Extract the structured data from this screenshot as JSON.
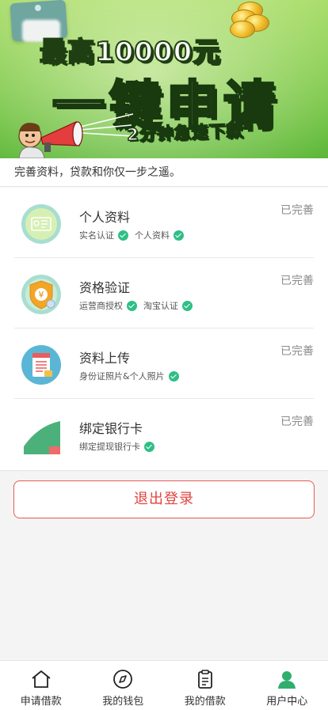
{
  "banner": {
    "headline": "最高10000元",
    "big_text": "一键申请",
    "sub_text": "2分钟急速下款"
  },
  "notice": "完善资料，贷款和你仅一步之遥。",
  "items": [
    {
      "title": "个人资料",
      "status": "已完善",
      "icon": "id-card-icon",
      "tags": [
        "实名认证",
        "个人资料"
      ]
    },
    {
      "title": "资格验证",
      "status": "已完善",
      "icon": "shield-yuan-icon",
      "tags": [
        "运营商授权",
        "淘宝认证"
      ]
    },
    {
      "title": "资料上传",
      "status": "已完善",
      "icon": "document-icon",
      "tags": [
        "身份证照片&个人照片"
      ]
    },
    {
      "title": "绑定银行卡",
      "status": "已完善",
      "icon": "bank-card-icon",
      "tags": [
        "绑定提现银行卡"
      ]
    }
  ],
  "logout_label": "退出登录",
  "tabs": [
    {
      "label": "申请借款",
      "icon": "home-icon"
    },
    {
      "label": "我的钱包",
      "icon": "compass-icon"
    },
    {
      "label": "我的借款",
      "icon": "clipboard-icon"
    },
    {
      "label": "用户中心",
      "icon": "user-icon",
      "active": true
    }
  ],
  "colors": {
    "accent_green": "#2fbf86",
    "logout_red": "#e0443e",
    "banner_green": "#7ec94a"
  }
}
